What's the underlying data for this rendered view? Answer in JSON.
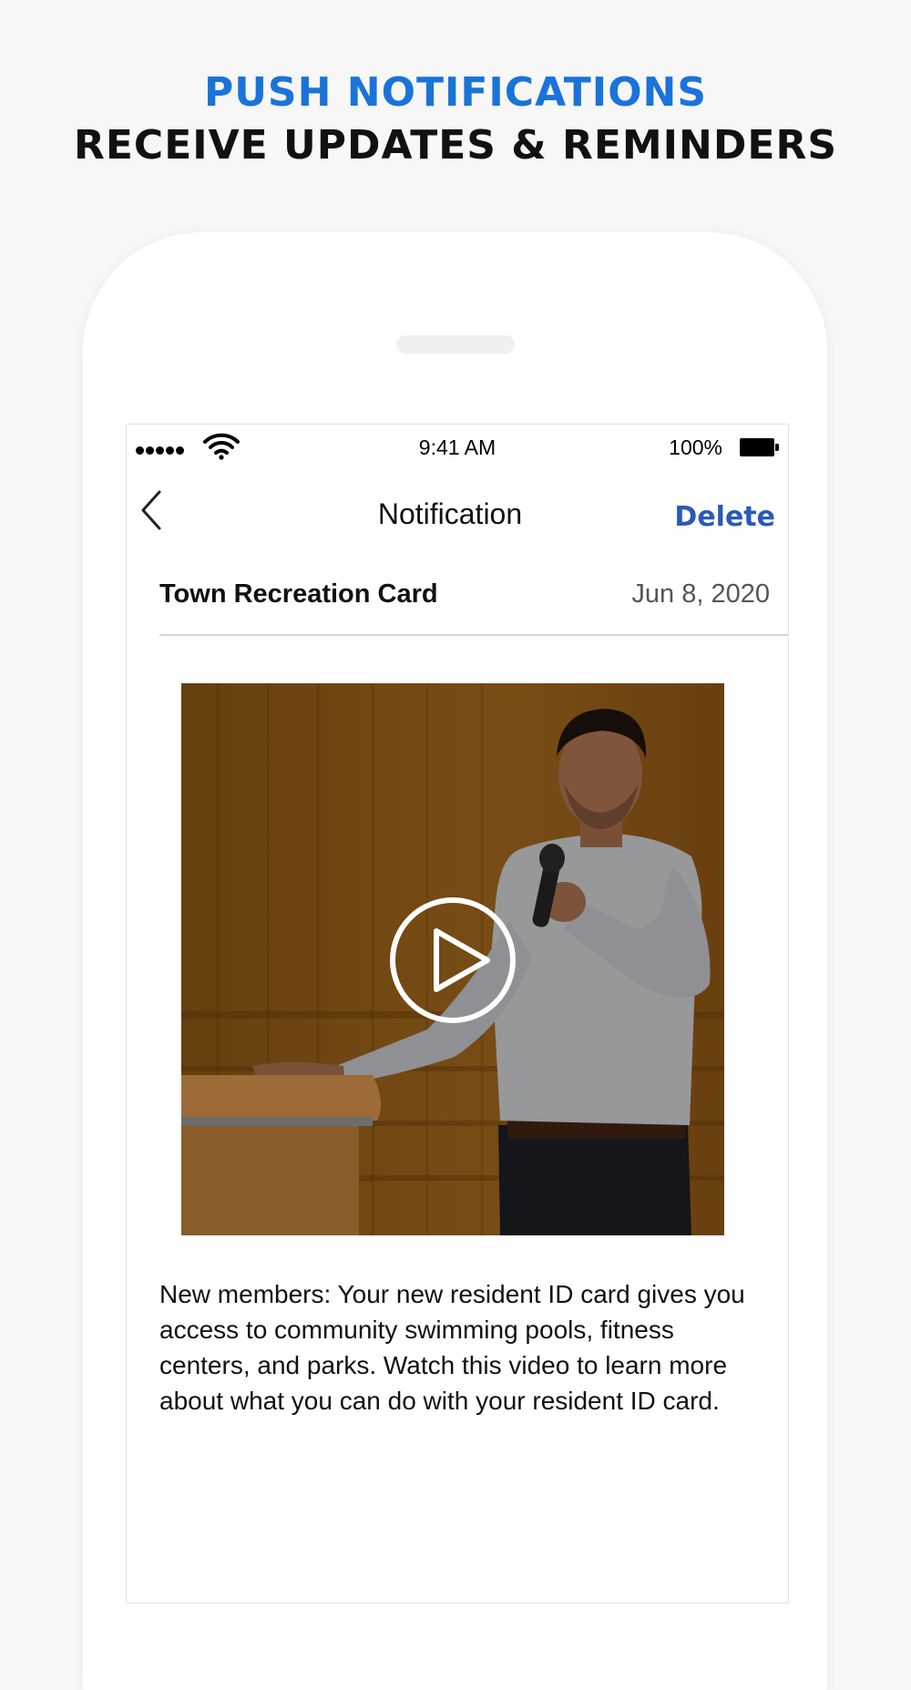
{
  "banner": {
    "title": "PUSH NOTIFICATIONS",
    "subtitle": "RECEIVE UPDATES & REMINDERS",
    "title_color": "#1a73d9"
  },
  "status_bar": {
    "time": "9:41 AM",
    "battery": "100%"
  },
  "nav": {
    "title": "Notification",
    "delete_label": "Delete",
    "accent_color": "#2a5ab8"
  },
  "notification": {
    "title": "Town Recreation Card",
    "date": "Jun 8, 2020",
    "body": "New members: Your new resident ID card gives you access to community swimming pools, fitness centers, and parks. Watch this video to learn more about what you can do with your resident ID card."
  },
  "icons": {
    "back": "chevron-left-icon",
    "play": "play-icon",
    "wifi": "wifi-icon",
    "battery": "battery-icon",
    "signal": "signal-dots-icon"
  }
}
